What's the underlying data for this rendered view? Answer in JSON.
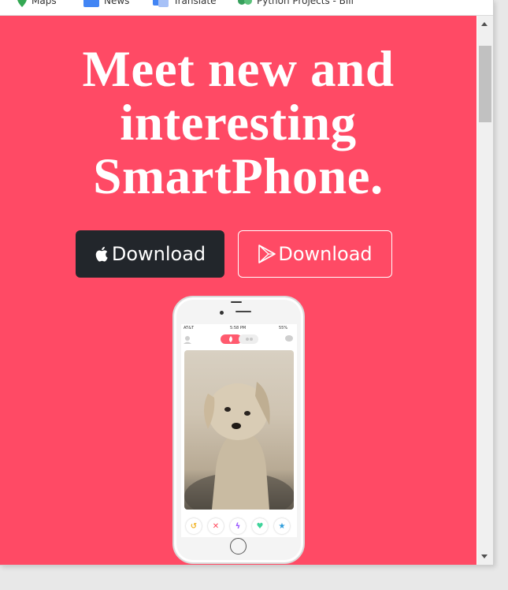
{
  "bookmarks": [
    {
      "label": "Maps",
      "icon": "maps-pin-icon"
    },
    {
      "label": "News",
      "icon": "news-icon"
    },
    {
      "label": "Translate",
      "icon": "translate-icon"
    },
    {
      "label": "Python Projects - Bill",
      "icon": "python-projects-icon"
    }
  ],
  "hero": {
    "line1": "Meet new and",
    "line2": "interesting",
    "line3": "SmartPhone."
  },
  "buttons": {
    "apple_label": "Download",
    "play_label": "Download"
  },
  "phone": {
    "carrier": "AT&T",
    "time": "5:58 PM",
    "battery": "55%"
  },
  "colors": {
    "background": "#ff4a65",
    "apple_button": "#22262b",
    "text": "#ffffff"
  }
}
